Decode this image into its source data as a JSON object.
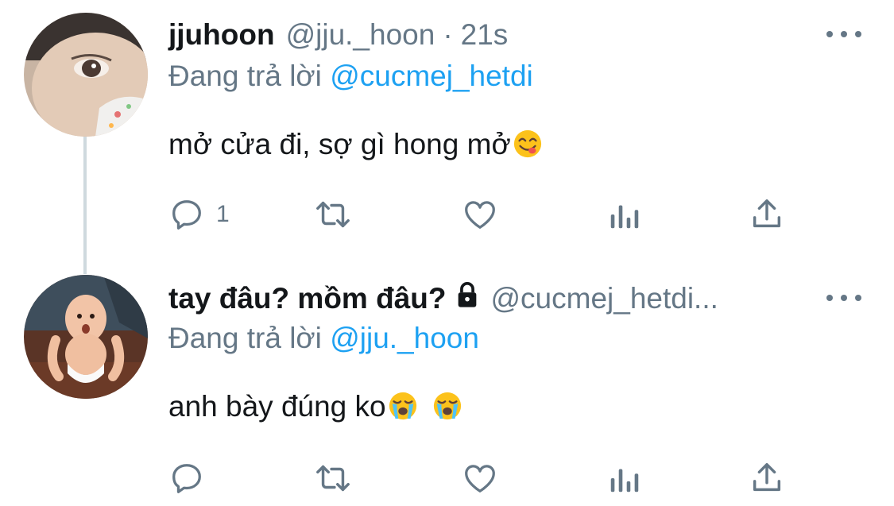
{
  "tweets": [
    {
      "name": "jjuhoon",
      "handle": "@jju._hoon",
      "separator": "·",
      "time": "21s",
      "replying_prefix": "Đang trả lời",
      "replying_to": "@cucmej_hetdi",
      "text": "mở cửa đi, sợ gì hong mở",
      "emojis": [
        "savoring-food-emoji"
      ],
      "reply_count": "1",
      "protected": false
    },
    {
      "name": "tay đâu? mồm đâu?",
      "handle": "@cucmej_hetdi...",
      "replying_prefix": "Đang trả lời",
      "replying_to": "@jju._hoon",
      "text": "anh bày đúng ko",
      "emojis": [
        "loudly-crying-emoji",
        "loudly-crying-emoji"
      ],
      "reply_count": "",
      "protected": true
    }
  ],
  "icons": {
    "reply": "reply-icon",
    "retweet": "retweet-icon",
    "like": "heart-icon",
    "analytics": "analytics-icon",
    "share": "share-icon",
    "more": "more-icon",
    "lock": "lock-icon"
  },
  "colors": {
    "link": "#1da1f2",
    "secondary_text": "#657786",
    "icon": "#657786",
    "thread_line": "#cfd9de"
  }
}
